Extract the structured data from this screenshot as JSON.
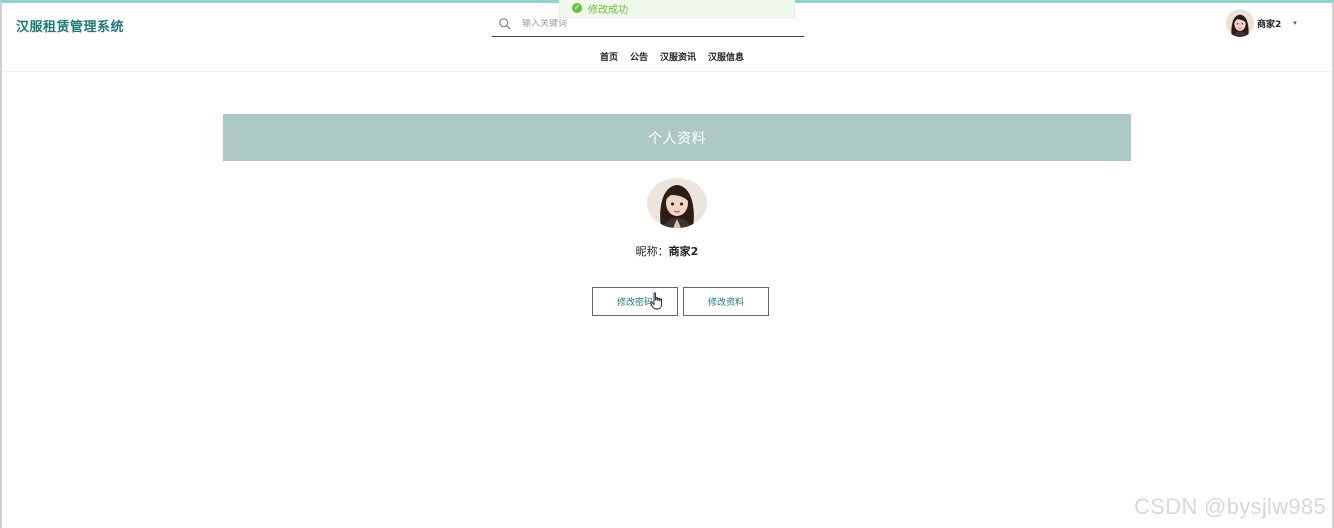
{
  "toast": {
    "message": "修改成功"
  },
  "header": {
    "logo": "汉服租赁管理系统",
    "search_placeholder": "输入关键词",
    "user_name": "商家2",
    "user_caret": "▾"
  },
  "nav": {
    "items": [
      "首页",
      "公告",
      "汉服资讯",
      "汉服信息"
    ]
  },
  "profile": {
    "banner_title": "个人资料",
    "nickname_label": "昵称：",
    "nickname_value": "商家2",
    "change_password_label": "修改密码",
    "edit_profile_label": "修改资料"
  },
  "watermark": "CSDN @bysjlw985",
  "colors": {
    "accent": "#1d7a75",
    "banner_bg": "#adc9c5",
    "toast_success": "#67c23a"
  }
}
